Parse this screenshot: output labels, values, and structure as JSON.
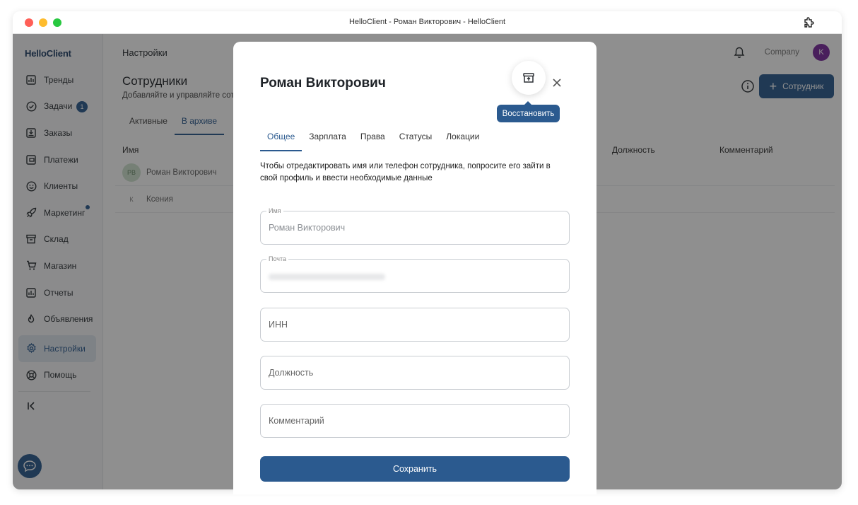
{
  "window": {
    "title": "HelloClient - Роман Викторович - HelloClient"
  },
  "sidebar": {
    "logo": "HelloClient",
    "items": [
      {
        "label": "Тренды",
        "icon": "chart-bars-icon"
      },
      {
        "label": "Задачи",
        "icon": "check-circle-icon",
        "badge": "1"
      },
      {
        "label": "Заказы",
        "icon": "inbox-download-icon"
      },
      {
        "label": "Платежи",
        "icon": "wallet-icon"
      },
      {
        "label": "Клиенты",
        "icon": "smile-icon"
      },
      {
        "label": "Маркетинг",
        "icon": "rocket-icon",
        "dot": true
      },
      {
        "label": "Склад",
        "icon": "archive-box-icon"
      },
      {
        "label": "Магазин",
        "icon": "cart-icon"
      },
      {
        "label": "Отчеты",
        "icon": "report-icon"
      },
      {
        "label": "Объявления",
        "icon": "megaphone-icon"
      },
      {
        "label": "Настройки",
        "icon": "gear-icon",
        "active": true
      },
      {
        "label": "Помощь",
        "icon": "lifebuoy-icon"
      }
    ],
    "collapse_icon": "collapse-left-icon"
  },
  "header": {
    "title": "Настройки",
    "company": "Company",
    "avatar_initial": "K"
  },
  "page": {
    "title": "Сотрудники",
    "subtitle": "Добавляйте и управляйте сотрудниками",
    "add_button": "Сотрудник",
    "tabs": [
      {
        "label": "Активные"
      },
      {
        "label": "В архиве",
        "active": true
      }
    ],
    "columns": {
      "name": "Имя",
      "position": "Должность",
      "comment": "Комментарий"
    },
    "rows": [
      {
        "initials": "РВ",
        "name": "Роман Викторович"
      },
      {
        "initials": "К",
        "name": "Ксения"
      }
    ]
  },
  "modal": {
    "title": "Роман Викторович",
    "restore_tooltip": "Восстановить",
    "tabs": [
      {
        "label": "Общее",
        "active": true
      },
      {
        "label": "Зарплата"
      },
      {
        "label": "Права"
      },
      {
        "label": "Статусы"
      },
      {
        "label": "Локации"
      }
    ],
    "note": "Чтобы отредактировать имя или телефон сотрудника, попросите его зайти в свой профиль и ввести необходимые данные",
    "fields": {
      "name": {
        "label": "Имя",
        "value": "Роман Викторович"
      },
      "email": {
        "label": "Почта"
      },
      "inn": {
        "placeholder": "ИНН"
      },
      "position": {
        "placeholder": "Должность"
      },
      "comment": {
        "placeholder": "Комментарий"
      }
    },
    "save_button": "Сохранить"
  },
  "colors": {
    "primary": "#2b5a8f",
    "avatar": "#7a2a9e",
    "overlay": "rgba(20,20,20,0.48)"
  }
}
